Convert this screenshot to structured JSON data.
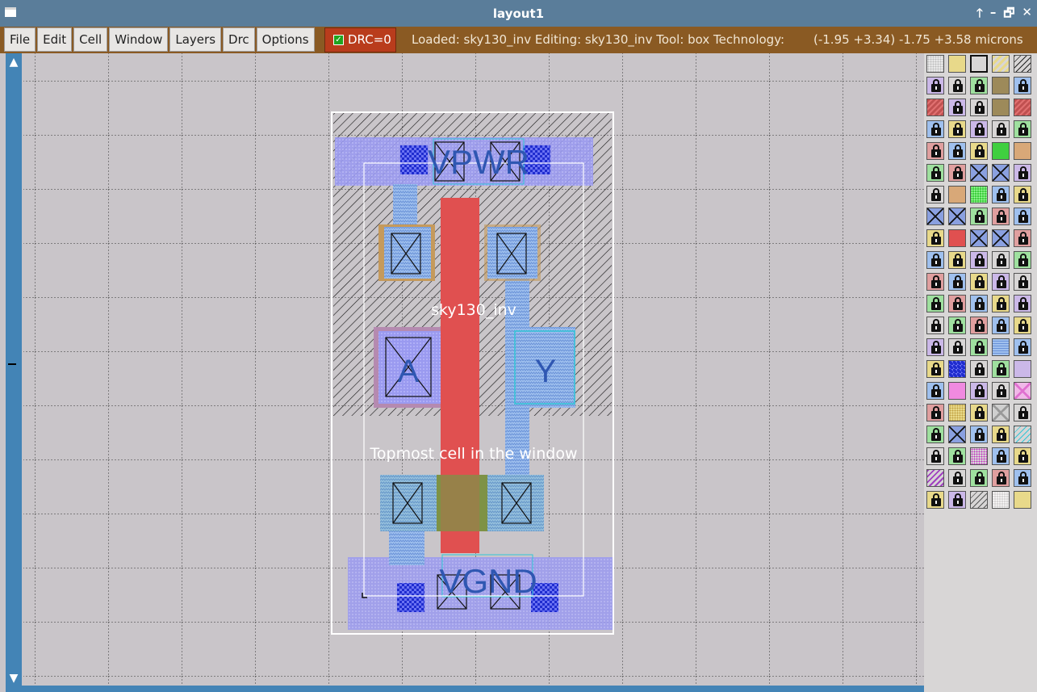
{
  "window": {
    "title": "layout1",
    "controls": [
      "🡑",
      "–",
      "🗗",
      "✕"
    ]
  },
  "menu": [
    "File",
    "Edit",
    "Cell",
    "Window",
    "Layers",
    "Drc",
    "Options"
  ],
  "drc": {
    "label": "DRC=0",
    "checked": true
  },
  "status": {
    "text": "Loaded: sky130_inv Editing: sky130_inv Tool: box  Technology:"
  },
  "coords": "(-1.95 +3.34) -1.75 +3.58 microns",
  "layout": {
    "cell_name": "sky130_inv",
    "cell_caption": "Topmost cell in the window",
    "labels": {
      "vpwr": "VPWR",
      "vgnd": "VGND",
      "a": "A",
      "y": "Y"
    }
  },
  "colors": {
    "titlebar": "#5a7d9a",
    "menubar": "#8a5a23",
    "canvas_bg": "#c9c5c9",
    "poly": "#e05050",
    "metal1": "#8e8ef2",
    "locali": "#9fc0ee",
    "ndiff": "#3fbf3f",
    "pdiff": "#c59a5c",
    "nwell": "#202020",
    "scrollbar": "#4384b6"
  },
  "layer_swatches": [
    "dots",
    "yellow",
    "outline",
    "yellowhatch",
    "diag",
    "lock",
    "lock",
    "lock",
    "brown",
    "lock",
    "redhatch",
    "lock",
    "lock",
    "brown",
    "redhatch",
    "lock",
    "lock",
    "lock",
    "lock",
    "lock",
    "lock",
    "lock",
    "lock",
    "green",
    "tan",
    "lock",
    "lock",
    "xbox",
    "xbox",
    "lock",
    "lock",
    "tan",
    "greendots",
    "lock",
    "lock",
    "xbox",
    "xbox",
    "lock",
    "lock",
    "lock",
    "lock",
    "red",
    "xbox",
    "xbox",
    "lock",
    "lock",
    "lock",
    "lock",
    "lock",
    "lock",
    "lock",
    "lock",
    "lock",
    "lock",
    "lock",
    "lock",
    "lock",
    "lock",
    "lock",
    "lock",
    "lock",
    "lock",
    "lock",
    "lock",
    "lock",
    "lock",
    "lock",
    "lock",
    "bluewave",
    "lock",
    "lock",
    "bluecheck",
    "lock",
    "lock",
    "lavender",
    "lock",
    "pink",
    "lock",
    "lock",
    "pinkx",
    "lock",
    "yellowdots",
    "lock",
    "greyx",
    "lock",
    "lock",
    "xbox",
    "lock",
    "lock",
    "cyanhatch",
    "lock",
    "lock",
    "magdots",
    "lock",
    "lock",
    "purplehatch",
    "lock",
    "lock",
    "lock",
    "lock",
    "lock",
    "lock",
    "greyhatch",
    "whitedots",
    "yellow"
  ]
}
